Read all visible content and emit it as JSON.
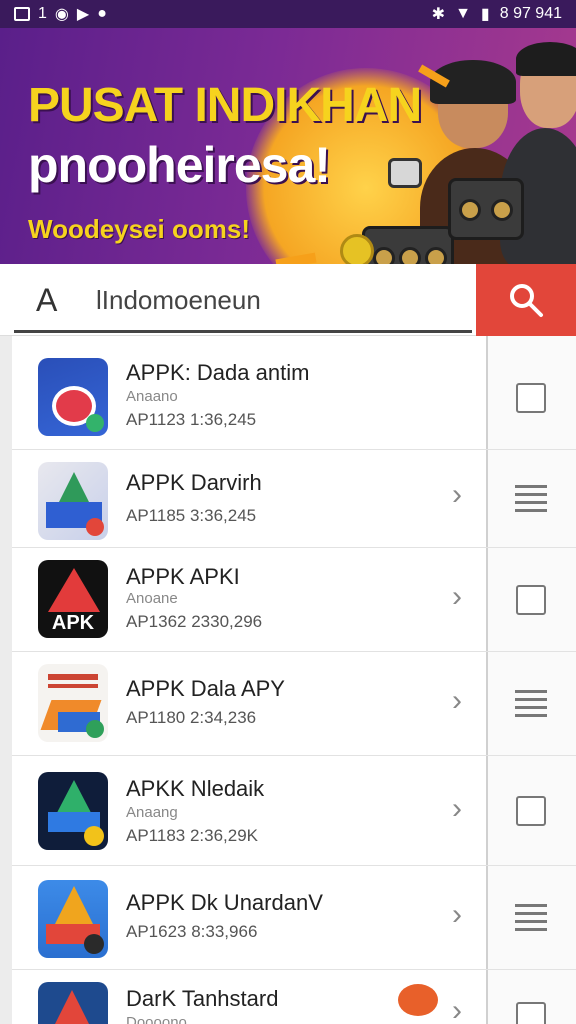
{
  "status_bar": {
    "left_text": "1",
    "time": "8 97 941"
  },
  "banner": {
    "title": "PUSAT INDIKHAN",
    "subtitle": "pnooheiresa!",
    "tagline": "Woodeysei ooms!"
  },
  "search": {
    "label_glyph": "A",
    "value": "lIndomoeneun",
    "button": "search"
  },
  "apps": [
    {
      "title": "APPK: Dada antim",
      "sub": "Anaano",
      "meta": "AP1123 1:36,245",
      "right": "checkbox",
      "chevron": false
    },
    {
      "title": "APPK Darvirh",
      "sub": "",
      "meta": "AP1185 3:36,245",
      "right": "menu",
      "chevron": true
    },
    {
      "title": "APPK APKI",
      "sub": "Anoane",
      "meta": "AP1362 2330,296",
      "right": "checkbox",
      "chevron": true
    },
    {
      "title": "APPK Dala APY",
      "sub": "",
      "meta": "AP1180 2:34,236",
      "right": "menu",
      "chevron": true
    },
    {
      "title": "APKK Nledaik",
      "sub": "Anaang",
      "meta": "AP1183 2:36,29K",
      "right": "checkbox",
      "chevron": true
    },
    {
      "title": "APPK Dk UnardanV",
      "sub": "",
      "meta": "AP1623 8:33,966",
      "right": "menu",
      "chevron": true
    },
    {
      "title": "DarK Tanhstard",
      "sub": "",
      "meta": "Doooono",
      "right": "checkbox",
      "chevron": true
    }
  ],
  "icon_labels": {
    "app3": "APK"
  },
  "colors": {
    "accent": "#e2463a",
    "banner_yellow": "#f6d31e",
    "banner_purple": "#5a1f8a"
  }
}
